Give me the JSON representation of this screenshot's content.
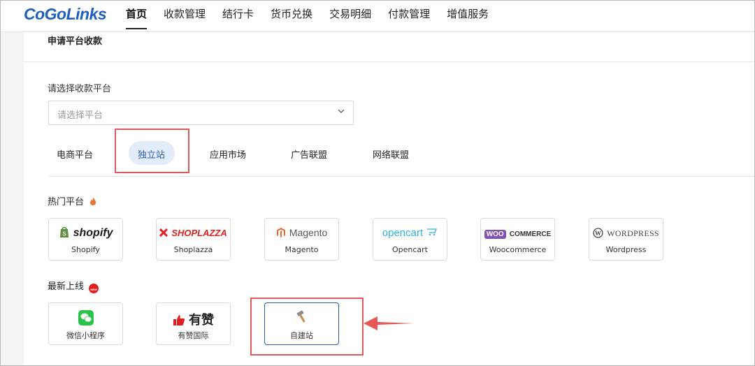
{
  "nav": {
    "logo": "CoGoLinks",
    "items": [
      "首页",
      "收款管理",
      "结行卡",
      "货币兑换",
      "交易明细",
      "付款管理",
      "增值服务"
    ]
  },
  "page": {
    "title": "申请平台收款",
    "field_label": "请选择收款平台",
    "select_placeholder": "请选择平台",
    "tabs": [
      "电商平台",
      "独立站",
      "应用市场",
      "广告联盟",
      "网络联盟"
    ],
    "active_tab": "独立站"
  },
  "hot": {
    "label": "热门平台",
    "platforms": [
      {
        "logo": "shopify",
        "name": "Shopify"
      },
      {
        "logo": "SHOPLAZZA",
        "name": "Shoplazza"
      },
      {
        "logo": "Magento",
        "name": "Magento"
      },
      {
        "logo": "opencart",
        "name": "Opencart"
      },
      {
        "logo_a": "WOO",
        "logo_b": "COMMERCE",
        "name": "Woocommerce"
      },
      {
        "logo": "WORDPRESS",
        "name": "Wordpress"
      }
    ]
  },
  "latest": {
    "label": "最新上线",
    "badge": "NEW",
    "platforms": [
      {
        "name": "微信小程序"
      },
      {
        "logo": "有赞",
        "name": "有赞国际"
      },
      {
        "name": "自建站"
      }
    ]
  },
  "colors": {
    "brand": "#1f5fbf",
    "highlight": "#e5585a",
    "active_tab_bg": "#e3ecfb",
    "active_tab_text": "#2a5db0"
  },
  "icons": [
    "shopify-bag-icon",
    "shoplazza-icon",
    "magento-icon",
    "opencart-cart-icon",
    "wordpress-icon",
    "wechat-icon",
    "thumbs-up-icon",
    "hammer-icon",
    "fire-icon",
    "chevron-down-icon"
  ]
}
